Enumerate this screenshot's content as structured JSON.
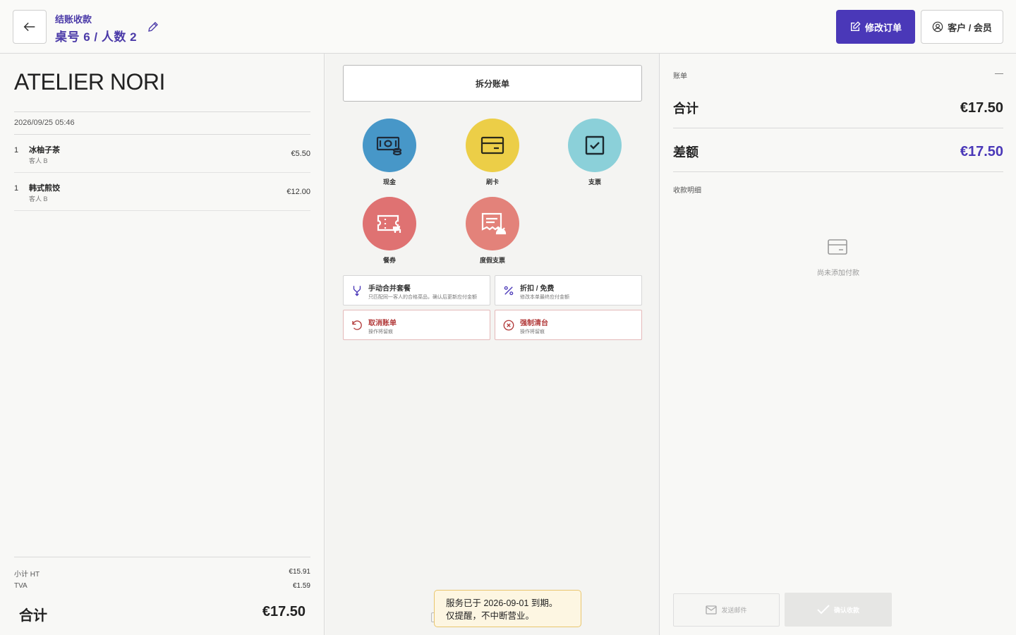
{
  "header": {
    "subtitle": "结账收款",
    "title": "桌号 6 / 人数 2",
    "modify_label": "修改订单",
    "customer_label": "客户 / 会员"
  },
  "receipt": {
    "shop_name": "ATELIER NORI",
    "datetime": "2026/09/25 05:46",
    "items": [
      {
        "qty": "1",
        "name": "冰柚子茶",
        "guest": "客人 B",
        "price": "€5.50"
      },
      {
        "qty": "1",
        "name": "韩式煎饺",
        "guest": "客人 B",
        "price": "€12.00"
      }
    ],
    "subtotal_label": "小计 HT",
    "subtotal_value": "€15.91",
    "tax_label": "TVA",
    "tax_value": "€1.59",
    "total_label": "合计",
    "total_value": "€17.50"
  },
  "middle": {
    "split_label": "拆分账单",
    "methods": [
      {
        "label": "现金",
        "icon": "cash-icon",
        "color": "#4797c8"
      },
      {
        "label": "刷卡",
        "icon": "card-icon",
        "color": "#ecce47"
      },
      {
        "label": "支票",
        "icon": "check-square-icon",
        "color": "#8bd0d9"
      },
      {
        "label": "餐券",
        "icon": "meal-voucher-icon",
        "color": "#df7272"
      },
      {
        "label": "度假支票",
        "icon": "holiday-voucher-icon",
        "color": "#e3827a"
      }
    ],
    "actions": [
      {
        "title": "手动合并套餐",
        "sub": "只匹配同一客人的合格菜品，确认后更新应付金额"
      },
      {
        "title": "折扣 / 免费",
        "sub": "修改本单最终应付金额"
      },
      {
        "title": "取消账单",
        "sub": "操作将留痕"
      },
      {
        "title": "强制清台",
        "sub": "操作将留痕"
      }
    ]
  },
  "bill": {
    "label": "账单",
    "total_label": "合计",
    "total_value": "€17.50",
    "diff_label": "差额",
    "diff_value": "€17.50",
    "details_label": "收款明细",
    "empty_text": "尚未添加付款",
    "email_label": "发送邮件",
    "confirm_label": "确认收款"
  },
  "toast": {
    "line1": "服务已于 2026-09-01 到期。",
    "line2": "仅提醒，不中断营业。"
  },
  "colors": {
    "accent": "#4a38b8",
    "danger": "#b23a3a",
    "warning_bg": "#fdf6e2"
  }
}
